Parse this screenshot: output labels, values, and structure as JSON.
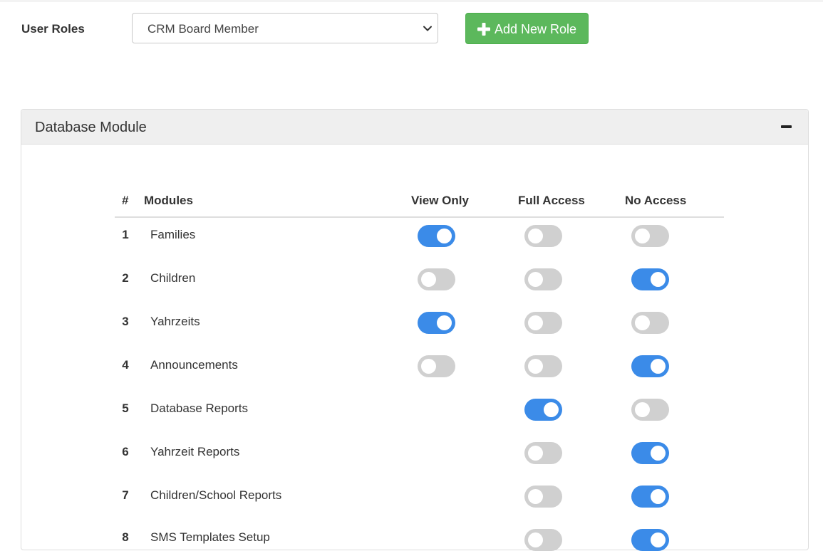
{
  "header": {
    "user_roles_label": "User Roles",
    "selected_role": "CRM Board Member",
    "add_role_label": "Add New Role"
  },
  "panel": {
    "title": "Database Module"
  },
  "table": {
    "columns": [
      "#",
      "Modules",
      "View Only",
      "Full Access",
      "No Access"
    ],
    "rows": [
      {
        "num": "1",
        "module": "Families",
        "view_only": true,
        "full_access": false,
        "no_access": false
      },
      {
        "num": "2",
        "module": "Children",
        "view_only": false,
        "full_access": false,
        "no_access": true
      },
      {
        "num": "3",
        "module": "Yahrzeits",
        "view_only": true,
        "full_access": false,
        "no_access": false
      },
      {
        "num": "4",
        "module": "Announcements",
        "view_only": false,
        "full_access": false,
        "no_access": true
      },
      {
        "num": "5",
        "module": "Database Reports",
        "view_only": null,
        "full_access": true,
        "no_access": false
      },
      {
        "num": "6",
        "module": "Yahrzeit Reports",
        "view_only": null,
        "full_access": false,
        "no_access": true
      },
      {
        "num": "7",
        "module": "Children/School Reports",
        "view_only": null,
        "full_access": false,
        "no_access": true
      },
      {
        "num": "8",
        "module": "SMS Templates Setup",
        "view_only": null,
        "full_access": false,
        "no_access": true
      }
    ]
  },
  "colors": {
    "toggle_on": "#3b8be8",
    "toggle_off": "#d0d0d0",
    "add_button": "#5cb85c"
  },
  "icons": {
    "select_chevron": "chevron-down-icon",
    "add_button": "plus-icon",
    "panel_collapse": "minus-icon"
  }
}
